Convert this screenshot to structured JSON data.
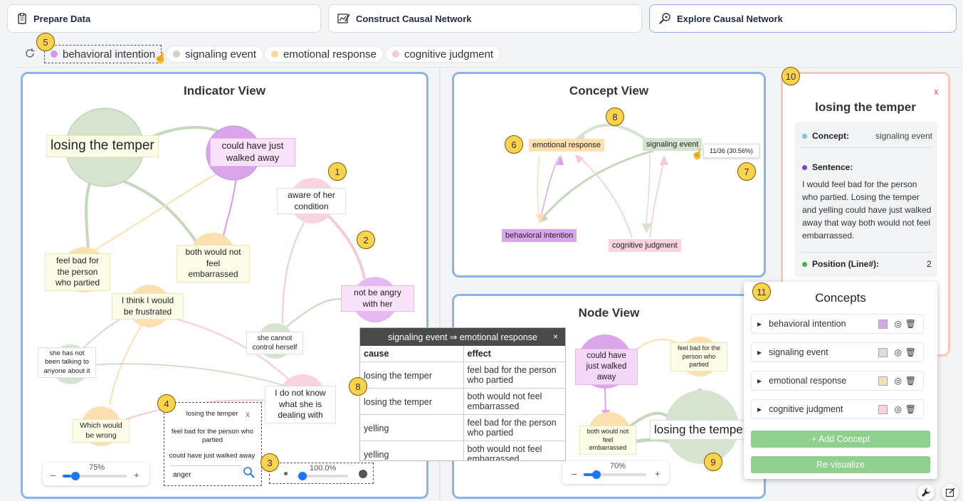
{
  "tabs": [
    {
      "label": "Prepare Data"
    },
    {
      "label": "Construct Causal Network"
    },
    {
      "label": "Explore Causal Network"
    }
  ],
  "legend": [
    {
      "label": "behavioral intention",
      "color": "#d49be6"
    },
    {
      "label": "signaling event",
      "color": "#c7d9bf"
    },
    {
      "label": "emotional response",
      "color": "#fcd89a"
    },
    {
      "label": "cognitive judgment",
      "color": "#f7c8d6"
    }
  ],
  "badges": [
    "1",
    "2",
    "3",
    "4",
    "5",
    "6",
    "7",
    "8",
    "9",
    "10",
    "11"
  ],
  "indicator_view": {
    "title": "Indicator View",
    "nodes": {
      "losing_temper": "losing the temper",
      "walked_away": "could have just walked away",
      "aware": "aware of her condition",
      "not_angry": "not be angry with her",
      "feel_bad": "feel bad for the person who partied",
      "embarrassed": "both would not feel embarrassed",
      "frustrated": "I think I would be frustrated",
      "not_talking": "she has not been talking to anyone about it",
      "control": "she cannot control herself",
      "dont_know": "I do not know what she is dealing with",
      "wrong": "Which would be wrong"
    },
    "zoom": {
      "minus": "–",
      "value": "75%",
      "plus": "+"
    },
    "search": {
      "items": [
        "losing the temper",
        "feel bad for the person who partied",
        "could have just walked away"
      ],
      "close": "x",
      "value": "anger"
    },
    "threshold": {
      "value": "100.0%"
    }
  },
  "concept_view": {
    "title": "Concept View",
    "nodes": {
      "emotional": "emotional response",
      "signaling": "signaling event",
      "behavioral": "behavioral intention",
      "cognitive": "cognitive judgment"
    },
    "tooltip": "11/36 (30.56%)"
  },
  "node_view": {
    "title": "Node View",
    "nodes": {
      "walked_away": "could have just walked away",
      "feel_bad": "feel bad for the person who partied",
      "embarrassed": "both would not feel embarrassed",
      "losing_temper": "losing the temper"
    },
    "zoom": {
      "minus": "–",
      "value": "70%",
      "plus": "+"
    }
  },
  "relation_popup": {
    "title": "signaling event ⇒ emotional response",
    "close": "×",
    "headers": [
      "cause",
      "effect"
    ],
    "rows": [
      [
        "losing the temper",
        "feel bad for the person who partied"
      ],
      [
        "losing the temper",
        "both would not feel embarrassed"
      ],
      [
        "yelling",
        "feel bad for the person who partied"
      ],
      [
        "yelling",
        "both would not feel embarrassed"
      ]
    ]
  },
  "detail_panel": {
    "close": "x",
    "title": "losing the temper",
    "concept_label": "Concept:",
    "concept_value": "signaling event",
    "sentence_label": "Sentence:",
    "sentence": "I would feel bad for the person who partied. Losing the temper and yelling could have just walked away that way both would not feel embarrassed.",
    "position_label": "Position (Line#):",
    "position_value": "2"
  },
  "concepts_panel": {
    "title": "Concepts",
    "items": [
      {
        "label": "behavioral intention",
        "color": "#d9a6ec"
      },
      {
        "label": "signaling event",
        "color": "#d5e3cf"
      },
      {
        "label": "emotional response",
        "color": "#fde0b0"
      },
      {
        "label": "cognitive judgment",
        "color": "#f9d4e0"
      }
    ],
    "add_label": "+ Add Concept",
    "revisualize_label": "Re-visualize"
  }
}
